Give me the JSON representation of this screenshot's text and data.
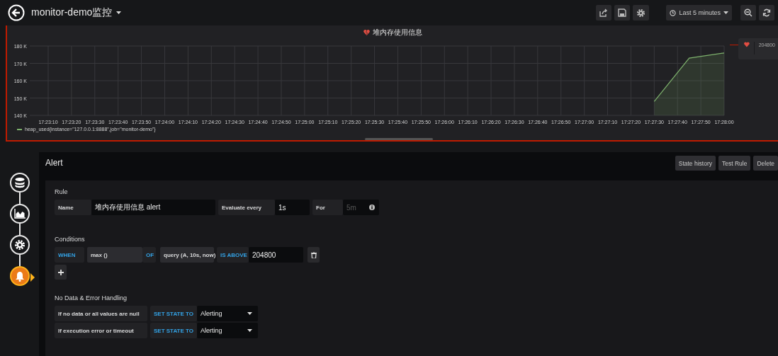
{
  "top_bar": {
    "title": "monitor-demo监控",
    "time_range": "Last 5 minutes"
  },
  "panel": {
    "title": "堆内存使用信息",
    "alerting": true,
    "threshold": "204800",
    "chart_data": {
      "type": "area",
      "grid": true,
      "ylim": [
        140000,
        180000
      ],
      "categories": [
        "17:23:10",
        null,
        "17:23:20",
        null,
        "17:23:30",
        null,
        "17:23:40",
        null,
        "17:23:50",
        null,
        "17:24:00",
        null,
        "17:24:10",
        null,
        "17:24:20",
        null,
        "17:24:30",
        null,
        "17:24:40",
        null,
        "17:24:50",
        null,
        "17:25:00",
        null,
        "17:25:10",
        null,
        "17:25:20",
        null,
        "17:25:30",
        null,
        "17:25:40",
        null,
        "17:25:50",
        null,
        "17:26:00",
        null,
        "17:26:10",
        null,
        "17:26:20",
        null,
        "17:26:30",
        null,
        "17:26:40",
        null,
        "17:26:50",
        null,
        "17:27:00",
        null,
        "17:27:10",
        null,
        "17:27:20",
        null,
        "17:27:30",
        null,
        "17:27:40",
        null,
        "17:27:50",
        null,
        "17:28:00"
      ],
      "series": [
        {
          "name": "heap_used{instance=\"127.0.0.1:8888\",job=\"monitor-demo\"}",
          "color": "#7eb26d",
          "values": [
            null,
            null,
            null,
            null,
            null,
            null,
            null,
            null,
            null,
            null,
            null,
            null,
            null,
            null,
            null,
            null,
            null,
            null,
            null,
            null,
            null,
            null,
            null,
            null,
            null,
            null,
            null,
            null,
            null,
            null,
            null,
            null,
            null,
            null,
            null,
            null,
            null,
            null,
            null,
            null,
            null,
            null,
            null,
            null,
            null,
            null,
            null,
            null,
            null,
            null,
            null,
            null,
            148000,
            null,
            null,
            173000,
            null,
            null,
            176000
          ]
        }
      ],
      "yticks": [
        {
          "value": 140000,
          "label": "140 K"
        },
        {
          "value": 150000,
          "label": "150 K"
        },
        {
          "value": 160000,
          "label": "160 K"
        },
        {
          "value": 170000,
          "label": "170 K"
        },
        {
          "value": 180000,
          "label": "180 K"
        }
      ]
    }
  },
  "editor_tabs": [
    {
      "kind": "database",
      "selected": false
    },
    {
      "kind": "chart",
      "selected": false
    },
    {
      "kind": "gear",
      "selected": false
    },
    {
      "kind": "bell",
      "selected": true
    }
  ],
  "alert": {
    "title": "Alert",
    "buttons": [
      "State history",
      "Test Rule",
      "Delete"
    ],
    "rule": {
      "heading": "Rule",
      "name_label": "Name",
      "name_value": "堆内存使用信息 alert",
      "every_label": "Evaluate every",
      "every_value": "1s",
      "for_label": "For",
      "for_placeholder": "5m"
    },
    "conditions": {
      "heading": "Conditions",
      "rows": [
        {
          "when": "WHEN",
          "reducer": "max ()",
          "of": "OF",
          "query": "query (A, 10s, now)",
          "evaluator": "IS ABOVE",
          "value": "204800"
        }
      ]
    },
    "no_data": {
      "heading": "No Data & Error Handling",
      "rows": [
        {
          "label": "If no data or all values are null",
          "action": "SET STATE TO",
          "value": "Alerting"
        },
        {
          "label": "If execution error or timeout",
          "action": "SET STATE TO",
          "value": "Alerting"
        }
      ]
    }
  }
}
